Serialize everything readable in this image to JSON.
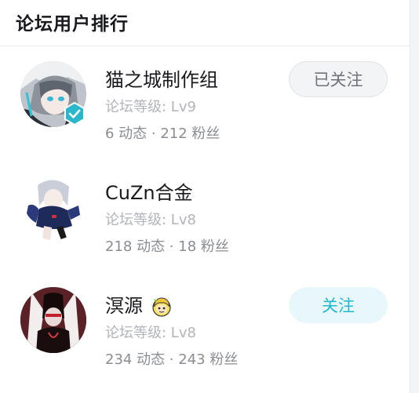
{
  "title": "论坛用户排行",
  "users": [
    {
      "name": "猫之城制作组",
      "level": "论坛等级: Lv9",
      "stats": "6 动态 · 212 粉丝",
      "button": "已关注",
      "verified": true
    },
    {
      "name": "CuZn合金",
      "level": "论坛等级: Lv8",
      "stats": "218 动态 · 18 粉丝",
      "button": "",
      "verified": false
    },
    {
      "name": "溟源",
      "level": "论坛等级: Lv8",
      "stats": "234 动态 · 243 粉丝",
      "button": "关注",
      "verified": false
    }
  ],
  "colors": {
    "accent": "#1fb8cf",
    "verified_badge": "#2bb6c9"
  }
}
